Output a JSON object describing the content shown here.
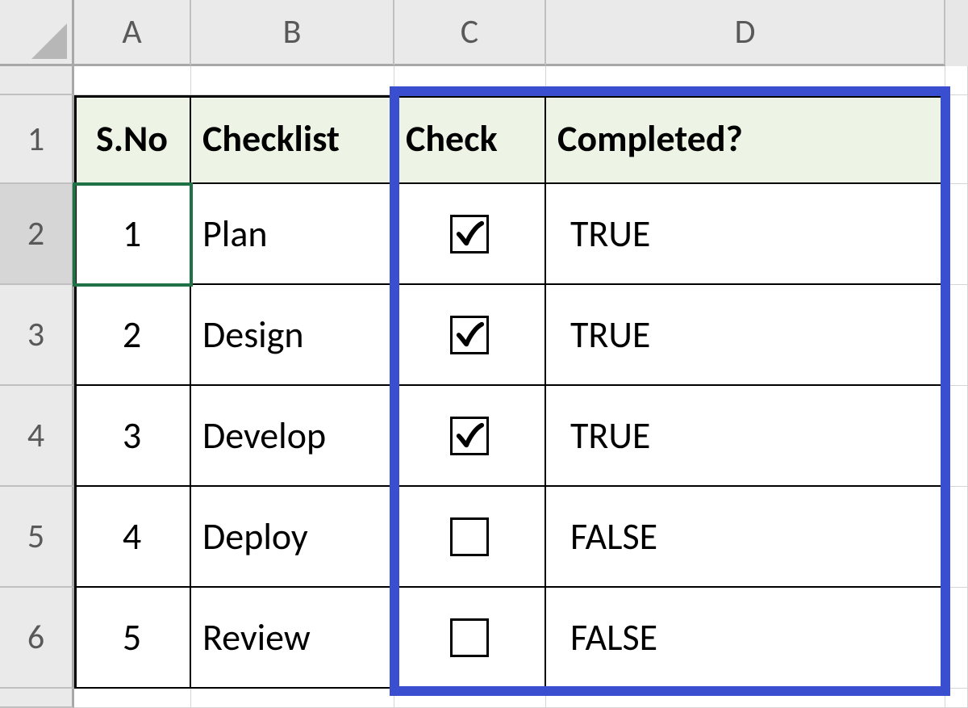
{
  "columns": [
    "A",
    "B",
    "C",
    "D"
  ],
  "row_numbers": [
    "1",
    "2",
    "3",
    "4",
    "5",
    "6"
  ],
  "headers": {
    "sno": "S.No",
    "checklist": "Checklist",
    "check": "Check",
    "completed": "Completed?"
  },
  "rows": [
    {
      "sno": "1",
      "checklist": "Plan",
      "checked": true,
      "completed": "TRUE"
    },
    {
      "sno": "2",
      "checklist": "Design",
      "checked": true,
      "completed": "TRUE"
    },
    {
      "sno": "3",
      "checklist": "Develop",
      "checked": true,
      "completed": "TRUE"
    },
    {
      "sno": "4",
      "checklist": "Deploy",
      "checked": false,
      "completed": "FALSE"
    },
    {
      "sno": "5",
      "checklist": "Review",
      "checked": false,
      "completed": "FALSE"
    }
  ],
  "active_cell": "A2",
  "highlight_columns": [
    "C",
    "D"
  ]
}
